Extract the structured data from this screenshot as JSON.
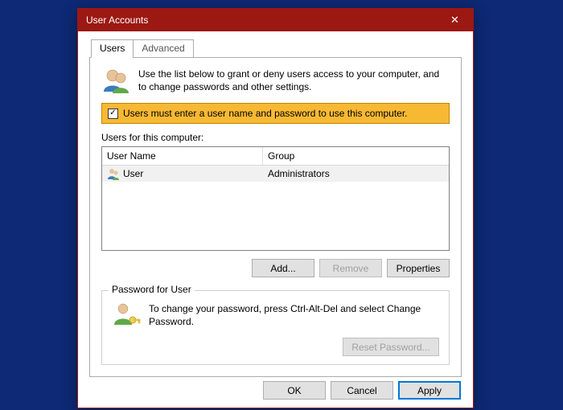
{
  "titlebar": {
    "title": "User Accounts"
  },
  "tabs": {
    "users": "Users",
    "advanced": "Advanced"
  },
  "intro": {
    "text": "Use the list below to grant or deny users access to your computer, and to change passwords and other settings."
  },
  "requireLogin": {
    "checked": true,
    "label": "Users must enter a user name and password to use this computer."
  },
  "listLabel": "Users for this computer:",
  "listHeaders": {
    "name": "User Name",
    "group": "Group"
  },
  "users": [
    {
      "name": "User",
      "group": "Administrators"
    }
  ],
  "buttons": {
    "add": "Add...",
    "remove": "Remove",
    "properties": "Properties",
    "resetPassword": "Reset Password...",
    "ok": "OK",
    "cancel": "Cancel",
    "apply": "Apply"
  },
  "passwordBox": {
    "legend": "Password for User",
    "text": "To change your password, press Ctrl-Alt-Del and select Change Password."
  }
}
